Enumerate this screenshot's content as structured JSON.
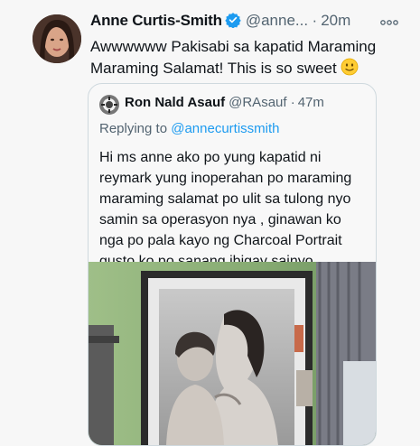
{
  "tweet": {
    "display_name": "Anne Curtis-Smith",
    "handle": "@anne...",
    "dot": "·",
    "time": "20m",
    "text_line1": "Awwwwww Pakisabi sa kapatid Maraming",
    "text_line2": "Maraming Salamat! This is so sweet",
    "emoji": "slightly-smiling-face-icon"
  },
  "quoted": {
    "display_name": "Ron Nald Asauf",
    "handle": "@RAsauf",
    "dot": "·",
    "time": "47m",
    "reply_prefix": "Replying to ",
    "reply_handle": "@annecurtissmith",
    "text_lines": [
      "Hi ms anne ako po yung kapatid ni",
      "reymark yung inoperahan po maraming",
      "maraming salamat po ulit sa tulong nyo",
      "samin sa operasyon nya , ginawan ko",
      "nga po pala kayo ng Charcoal Portrait",
      "gusto ko po sanang ibigay sainyo"
    ]
  },
  "colors": {
    "link": "#1d9bf0",
    "secondary_text": "#536471",
    "verified": "#1d9bf0"
  }
}
